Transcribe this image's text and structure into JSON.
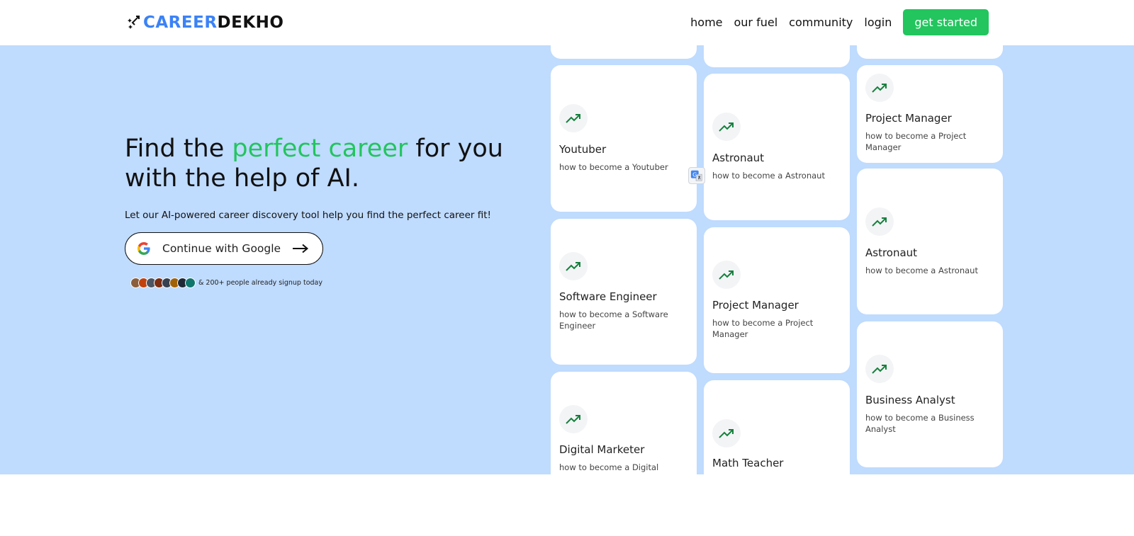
{
  "header": {
    "logo_part1": "CAREER",
    "logo_part2": "DEKHO",
    "nav": [
      "home",
      "our fuel",
      "community",
      "login"
    ],
    "cta": "get started"
  },
  "hero": {
    "headline_pre": "Find the ",
    "headline_highlight": "perfect career",
    "headline_post": " for you with the help of AI.",
    "subtext": "Let our AI-powered career discovery tool help you find the perfect career fit!",
    "google_button": "Continue with Google",
    "social_proof": "& 200+ people already signup today"
  },
  "cards": {
    "col1": [
      {
        "title": "Youtuber",
        "subtitle": "how to become a Youtuber"
      },
      {
        "title": "Software Engineer",
        "subtitle": "how to become a Software Engineer"
      },
      {
        "title": "Digital Marketer",
        "subtitle": "how to become a Digital"
      }
    ],
    "col2": [
      {
        "title": "Astronaut",
        "subtitle": "how to become a Astronaut"
      },
      {
        "title": "Project Manager",
        "subtitle": "how to become a Project Manager"
      },
      {
        "title": "Math Teacher",
        "subtitle": ""
      }
    ],
    "col3": [
      {
        "title": "Project Manager",
        "subtitle": "how to become a Project Manager"
      },
      {
        "title": "Astronaut",
        "subtitle": "how to become a Astronaut"
      },
      {
        "title": "Business Analyst",
        "subtitle": "how to become a Business Analyst"
      }
    ]
  },
  "colors": {
    "brand_blue": "#3b82f6",
    "accent_green": "#22c55e",
    "hero_bg": "#bfdbfe",
    "trend_green": "#15803d"
  },
  "icons": [
    "logo-mark-icon",
    "google-icon",
    "arrow-right-icon",
    "trend-up-icon",
    "translate-icon"
  ]
}
